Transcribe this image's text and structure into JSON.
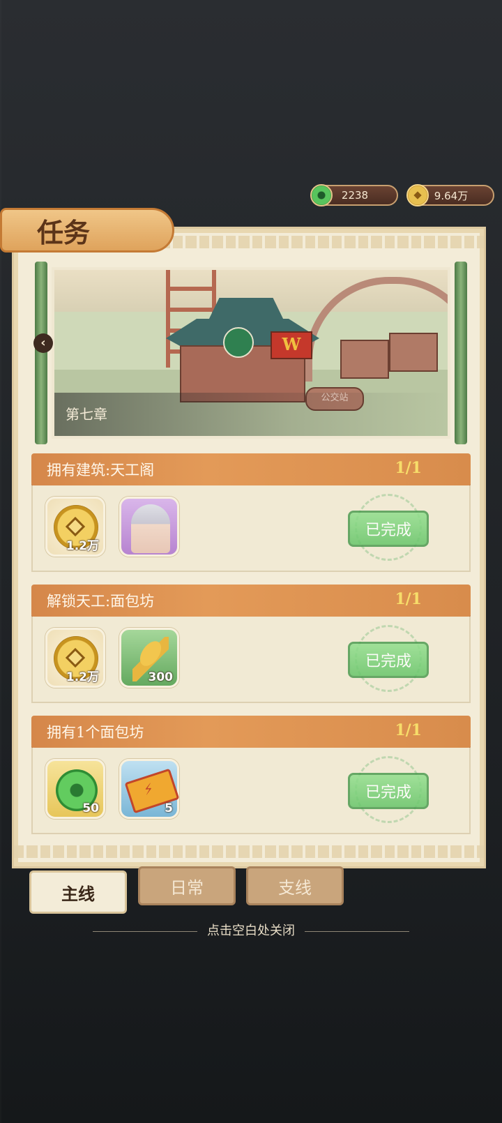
{
  "currency": {
    "jade": {
      "value": "2238",
      "icon": "jade-coin-icon"
    },
    "gold": {
      "value": "9.64万",
      "icon": "gold-coin-icon"
    }
  },
  "panel": {
    "title": "任务",
    "chapter": "第七章",
    "scene_sign": "公交站",
    "building_sign": "W"
  },
  "tasks": [
    {
      "title": "拥有建筑:天工阁",
      "progress": "1/1",
      "rewards": [
        {
          "icon": "gold-coin-icon",
          "qty": "1.2万"
        },
        {
          "icon": "character-portrait-icon",
          "qty": ""
        }
      ],
      "status": "已完成"
    },
    {
      "title": "解锁天工:面包坊",
      "progress": "1/1",
      "rewards": [
        {
          "icon": "gold-coin-icon",
          "qty": "1.2万"
        },
        {
          "icon": "wheat-icon",
          "qty": "300"
        }
      ],
      "status": "已完成"
    },
    {
      "title": "拥有1个面包坊",
      "progress": "1/1",
      "rewards": [
        {
          "icon": "jade-coin-icon",
          "qty": "50"
        },
        {
          "icon": "ticket-icon",
          "qty": "5"
        }
      ],
      "status": "已完成"
    }
  ],
  "tabs": [
    {
      "label": "主线",
      "active": true
    },
    {
      "label": "日常",
      "active": false
    },
    {
      "label": "支线",
      "active": false
    }
  ],
  "close_hint": "点击空白处关闭",
  "colors": {
    "accent_orange": "#d88c4c",
    "done_green": "#67c56a",
    "parchment": "#f3ecd8"
  }
}
